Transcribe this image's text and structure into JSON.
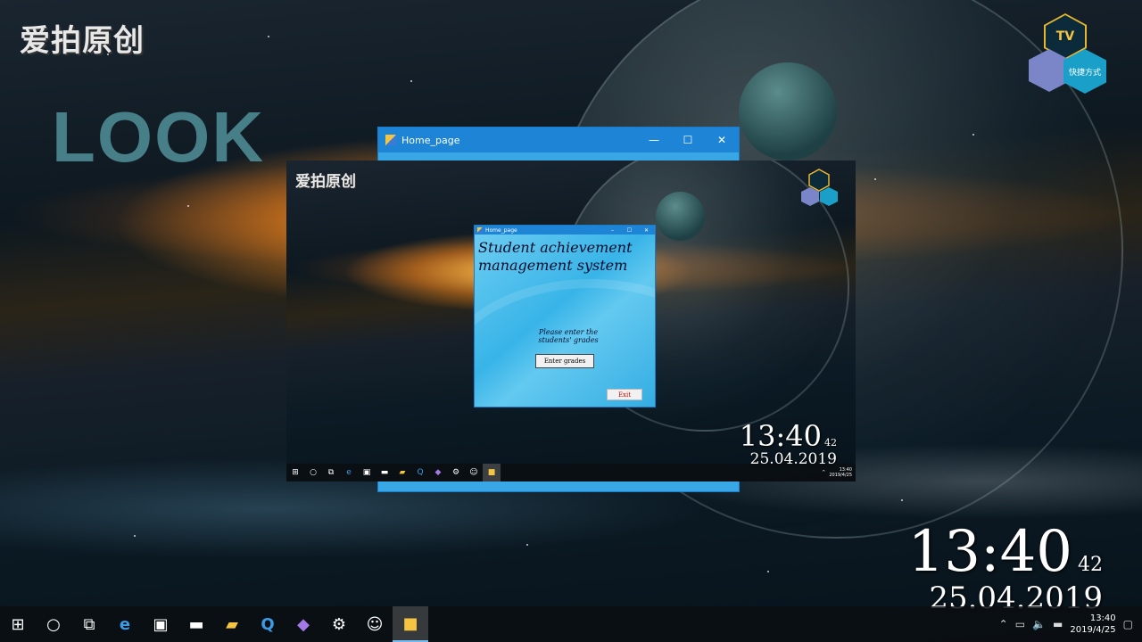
{
  "desktop": {
    "watermark": "爱拍原创",
    "look_text": "LOOK",
    "tv_label": "TV",
    "shortcut_label": "快捷方式",
    "clock": {
      "time": "13:40",
      "seconds": "42",
      "date": "25.04.2019"
    }
  },
  "taskbar": {
    "icons": [
      "windows-start-icon",
      "cortana-search-icon",
      "task-view-icon",
      "edge-icon",
      "store-icon",
      "terminal-icon",
      "file-explorer-icon",
      "app-q-icon",
      "visual-studio-icon",
      "settings-gear-icon",
      "user-app-icon",
      "home-page-app-icon"
    ],
    "tray_time": "13:40",
    "tray_date": "2019/4/25"
  },
  "background_window": {
    "title": "Home_page",
    "controls": {
      "minimize": "—",
      "maximize": "☐",
      "close": "✕"
    }
  },
  "recorded_frame": {
    "watermark": "爱拍原创",
    "clock": {
      "time": "13:40",
      "seconds": "42",
      "date": "25.04.2019"
    },
    "tray_time": "13:40",
    "tray_date": "2019/4/25",
    "app_window": {
      "title": "Home_page",
      "controls": {
        "minimize": "–",
        "maximize": "☐",
        "close": "✕"
      },
      "heading": "Student achievement\nmanagement system",
      "prompt": "Please enter the\nstudents' grades",
      "enter_button": "Enter grades",
      "exit_button": "Exit"
    }
  }
}
